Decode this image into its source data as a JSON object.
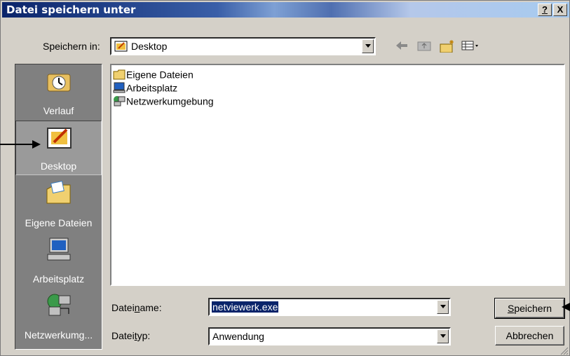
{
  "window": {
    "title": "Datei speichern unter",
    "help_glyph": "?",
    "close_glyph": "X"
  },
  "lookin": {
    "label": "Speichern in:",
    "value": "Desktop",
    "icon": "desktop-icon"
  },
  "toolbar": {
    "icons": [
      "back-icon",
      "up-folder-icon",
      "new-folder-icon",
      "view-menu-icon"
    ]
  },
  "places": [
    {
      "label": "Verlauf",
      "icon": "history-icon",
      "selected": false
    },
    {
      "label": "Desktop",
      "icon": "desktop-icon",
      "selected": true
    },
    {
      "label": "Eigene Dateien",
      "icon": "my-documents-icon",
      "selected": false
    },
    {
      "label": "Arbeitsplatz",
      "icon": "my-computer-icon",
      "selected": false
    },
    {
      "label": "Netzwerkumg...",
      "icon": "network-icon",
      "selected": false
    }
  ],
  "files": [
    {
      "name": "Eigene Dateien",
      "icon": "folder-icon"
    },
    {
      "name": "Arbeitsplatz",
      "icon": "computer-icon"
    },
    {
      "name": "Netzwerkumgebung",
      "icon": "network-icon"
    }
  ],
  "filename": {
    "label_pre": "Datei",
    "label_underlined": "n",
    "label_post": "ame:",
    "value": "netviewerk.exe"
  },
  "filetype": {
    "label_pre": "Datei",
    "label_underlined": "t",
    "label_post": "yp:",
    "value": "Anwendung"
  },
  "buttons": {
    "save_underlined": "S",
    "save_rest": "peichern",
    "cancel": "Abbrechen"
  },
  "colors": {
    "titlebar_start": "#0a246a",
    "dialog_bg": "#d4d0c8",
    "places_bg": "#808080",
    "selection": "#0a246a"
  }
}
